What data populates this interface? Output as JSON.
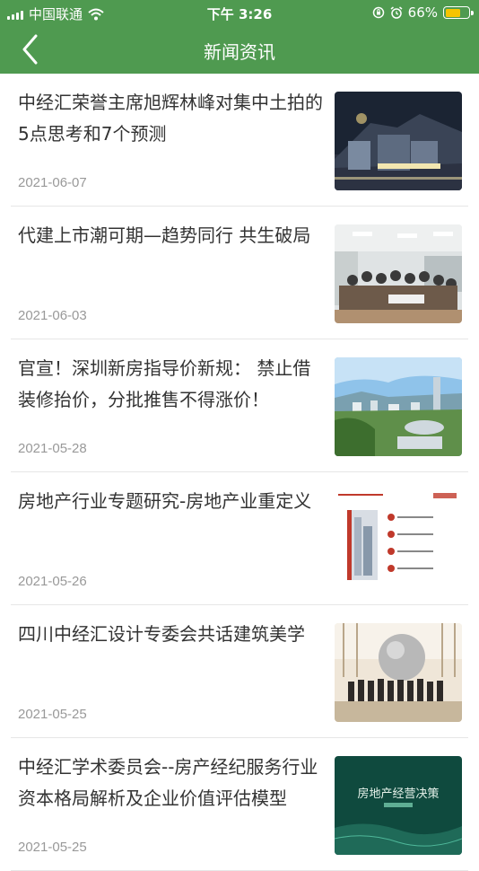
{
  "status_bar": {
    "carrier": "中国联通",
    "time": "下午 3:26",
    "battery": "66%",
    "battery_level": 0.66,
    "icons": [
      "signal-icon",
      "wifi-icon",
      "orientation-lock-icon",
      "alarm-icon",
      "battery-icon"
    ]
  },
  "nav": {
    "title": "新闻资讯",
    "back_icon": "chevron-left-icon",
    "color": "#4f9a50"
  },
  "news": [
    {
      "title": "中经汇荣誉主席旭辉林峰对集中土拍的5点思考和7个预测",
      "date": "2021-06-07"
    },
    {
      "title": "代建上市潮可期—趋势同行 共生破局",
      "date": "2021-06-03"
    },
    {
      "title": "官宣！深圳新房指导价新规： 禁止借装修抬价，分批推售不得涨价！",
      "date": "2021-05-28"
    },
    {
      "title": "房地产行业专题研究-房地产业重定义",
      "date": "2021-05-26"
    },
    {
      "title": "四川中经汇设计专委会共话建筑美学",
      "date": "2021-05-25"
    },
    {
      "title": "中经汇学术委员会--房产经纪服务行业资本格局解析及企业价值评估模型",
      "date": "2021-05-25",
      "thumb_text": "房地产经营决策"
    }
  ]
}
